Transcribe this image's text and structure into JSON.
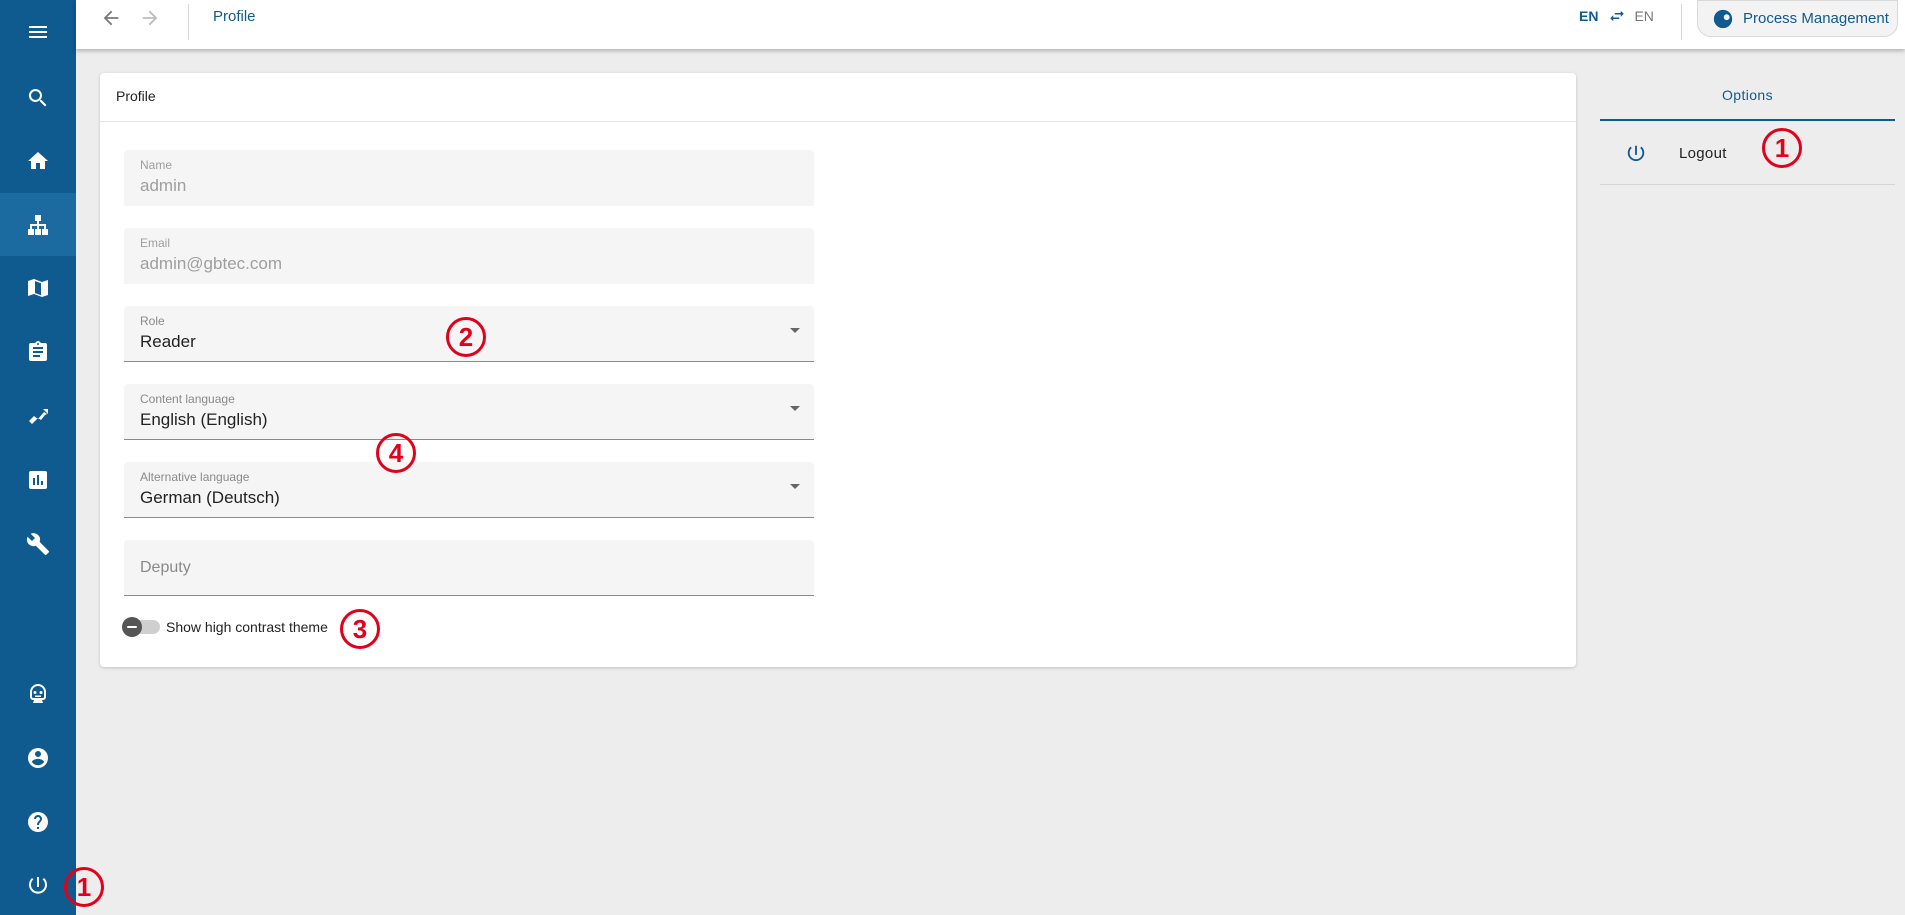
{
  "topbar": {
    "title": "Profile",
    "lang_active": "EN",
    "lang_inactive": "EN",
    "app_button": "Process Management"
  },
  "sidebar": {
    "top_items": [
      {
        "icon": "menu-icon"
      },
      {
        "icon": "search-icon"
      },
      {
        "icon": "home-icon"
      },
      {
        "icon": "sitemap-icon",
        "active": true
      },
      {
        "icon": "book-map-icon"
      },
      {
        "icon": "clipboard-icon"
      },
      {
        "icon": "trend-chart-icon"
      },
      {
        "icon": "bar-chart-icon"
      },
      {
        "icon": "wrench-icon"
      }
    ],
    "bottom_items": [
      {
        "icon": "robot-icon"
      },
      {
        "icon": "account-icon"
      },
      {
        "icon": "help-icon"
      },
      {
        "icon": "power-icon"
      }
    ]
  },
  "profile": {
    "title": "Profile",
    "name": {
      "label": "Name",
      "value": "admin"
    },
    "email": {
      "label": "Email",
      "value": "admin@gbtec.com"
    },
    "role": {
      "label": "Role",
      "value": "Reader"
    },
    "content_language": {
      "label": "Content language",
      "value": "English (English)"
    },
    "alternative_language": {
      "label": "Alternative language",
      "value": "German (Deutsch)"
    },
    "deputy": {
      "placeholder": "Deputy"
    },
    "high_contrast": {
      "label": "Show high contrast theme",
      "checked": false
    }
  },
  "options": {
    "title": "Options",
    "logout": "Logout"
  },
  "callouts": {
    "c1a": "1",
    "c1b": "1",
    "c2": "2",
    "c3": "3",
    "c4": "4"
  },
  "colors": {
    "brand": "#0f5a8e",
    "callout": "#e2001a",
    "background": "#ededed"
  }
}
